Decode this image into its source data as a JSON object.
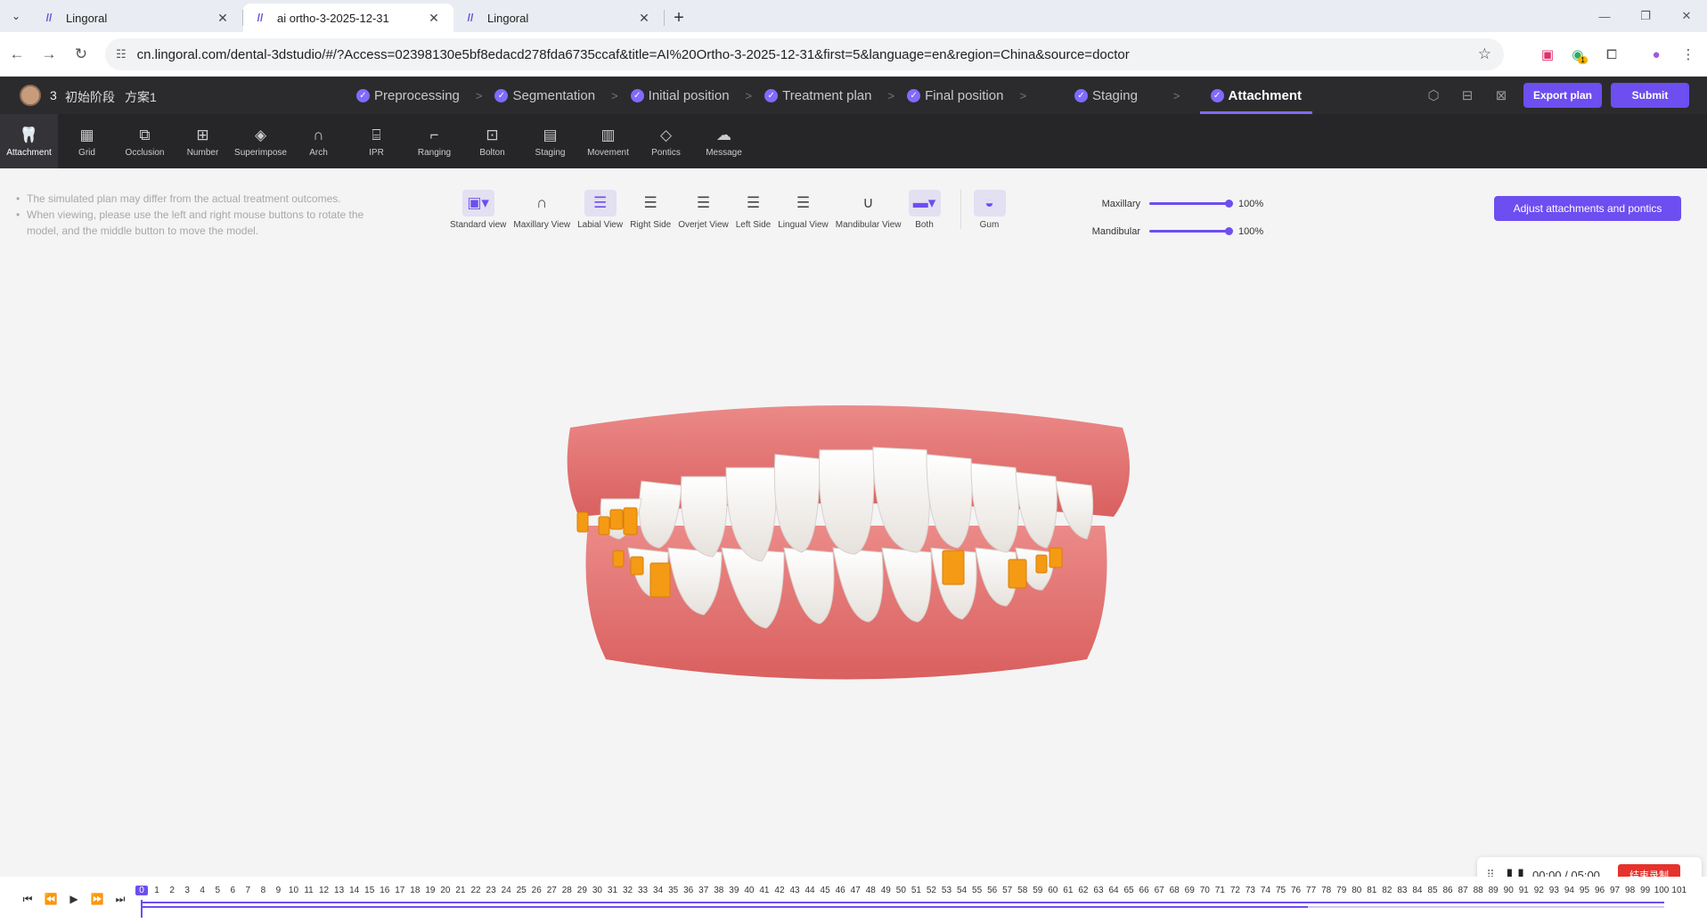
{
  "browser": {
    "tabs": [
      {
        "title": "Lingoral",
        "active": false
      },
      {
        "title": "ai ortho-3-2025-12-31",
        "active": true
      },
      {
        "title": "Lingoral",
        "active": false
      }
    ],
    "url": "cn.lingoral.com/dental-3dstudio/#/?Access=02398130e5bf8edacd278fda6735ccaf&title=AI%20Ortho-3-2025-12-31&first=5&language=en&region=China&source=doctor",
    "extension_badge": "1"
  },
  "header": {
    "case_number": "3",
    "stage_name": "初始阶段",
    "plan_name": "方案1",
    "steps": [
      {
        "label": "Preprocessing",
        "done": true
      },
      {
        "label": "Segmentation",
        "done": true
      },
      {
        "label": "Initial position",
        "done": true
      },
      {
        "label": "Treatment plan",
        "done": true
      },
      {
        "label": "Final position",
        "done": true
      },
      {
        "label": "Staging",
        "done": true
      },
      {
        "label": "Attachment",
        "done": true,
        "current": true
      }
    ],
    "export_label": "Export plan",
    "submit_label": "Submit"
  },
  "toolbar": [
    {
      "label": "Attachment",
      "icon": "tooth-icon",
      "glyph": "🦷",
      "active": true
    },
    {
      "label": "Grid",
      "icon": "grid-icon",
      "glyph": "▦"
    },
    {
      "label": "Occlusion",
      "icon": "occlusion-icon",
      "glyph": "⧉"
    },
    {
      "label": "Number",
      "icon": "number-icon",
      "glyph": "⊞"
    },
    {
      "label": "Superimpose",
      "icon": "layers-icon",
      "glyph": "◈"
    },
    {
      "label": "Arch",
      "icon": "arch-icon",
      "glyph": "∩"
    },
    {
      "label": "IPR",
      "icon": "ipr-icon",
      "glyph": "⌸"
    },
    {
      "label": "Ranging",
      "icon": "ranging-icon",
      "glyph": "⌐"
    },
    {
      "label": "Bolton",
      "icon": "bolton-icon",
      "glyph": "⊡"
    },
    {
      "label": "Staging",
      "icon": "staging-icon",
      "glyph": "▤"
    },
    {
      "label": "Movement",
      "icon": "movement-icon",
      "glyph": "▥"
    },
    {
      "label": "Pontics",
      "icon": "pontics-icon",
      "glyph": "◇"
    },
    {
      "label": "Message",
      "icon": "message-icon",
      "glyph": "☁"
    }
  ],
  "tips": [
    "The simulated plan may differ from the actual treatment outcomes.",
    "When viewing, please use the left and right mouse buttons to rotate the model, and the middle button to move the model."
  ],
  "views": [
    {
      "label": "Standard view",
      "icon": "standard-view-icon",
      "glyph": "▣▾",
      "selected": true
    },
    {
      "label": "Maxillary View",
      "icon": "maxillary-view-icon",
      "glyph": "∩"
    },
    {
      "label": "Labial View",
      "icon": "labial-view-icon",
      "glyph": "☰",
      "selected": true
    },
    {
      "label": "Right Side",
      "icon": "right-side-icon",
      "glyph": "☰"
    },
    {
      "label": "Overjet View",
      "icon": "overjet-view-icon",
      "glyph": "☰"
    },
    {
      "label": "Left Side",
      "icon": "left-side-icon",
      "glyph": "☰"
    },
    {
      "label": "Lingual View",
      "icon": "lingual-view-icon",
      "glyph": "☰"
    },
    {
      "label": "Mandibular View",
      "icon": "mandibular-view-icon",
      "glyph": "∪"
    },
    {
      "label": "Both",
      "icon": "both-icon",
      "glyph": "▬▾",
      "selected": true
    }
  ],
  "gum": {
    "label": "Gum",
    "icon": "gum-icon",
    "glyph": "◒"
  },
  "opacity": {
    "maxillary": {
      "label": "Maxillary",
      "value": "100%",
      "level": 1.0
    },
    "mandibular": {
      "label": "Mandibular",
      "value": "100%",
      "level": 1.0
    }
  },
  "adjust_label": "Adjust attachments and pontics",
  "recorder": {
    "time": "00:00 / 05:00",
    "stop_label": "结束录制"
  },
  "timeline": {
    "current": 0,
    "max": 101
  },
  "colors": {
    "accent": "#6d4ef0",
    "attachment": "#f59a14",
    "gum": "#e47a7a"
  }
}
